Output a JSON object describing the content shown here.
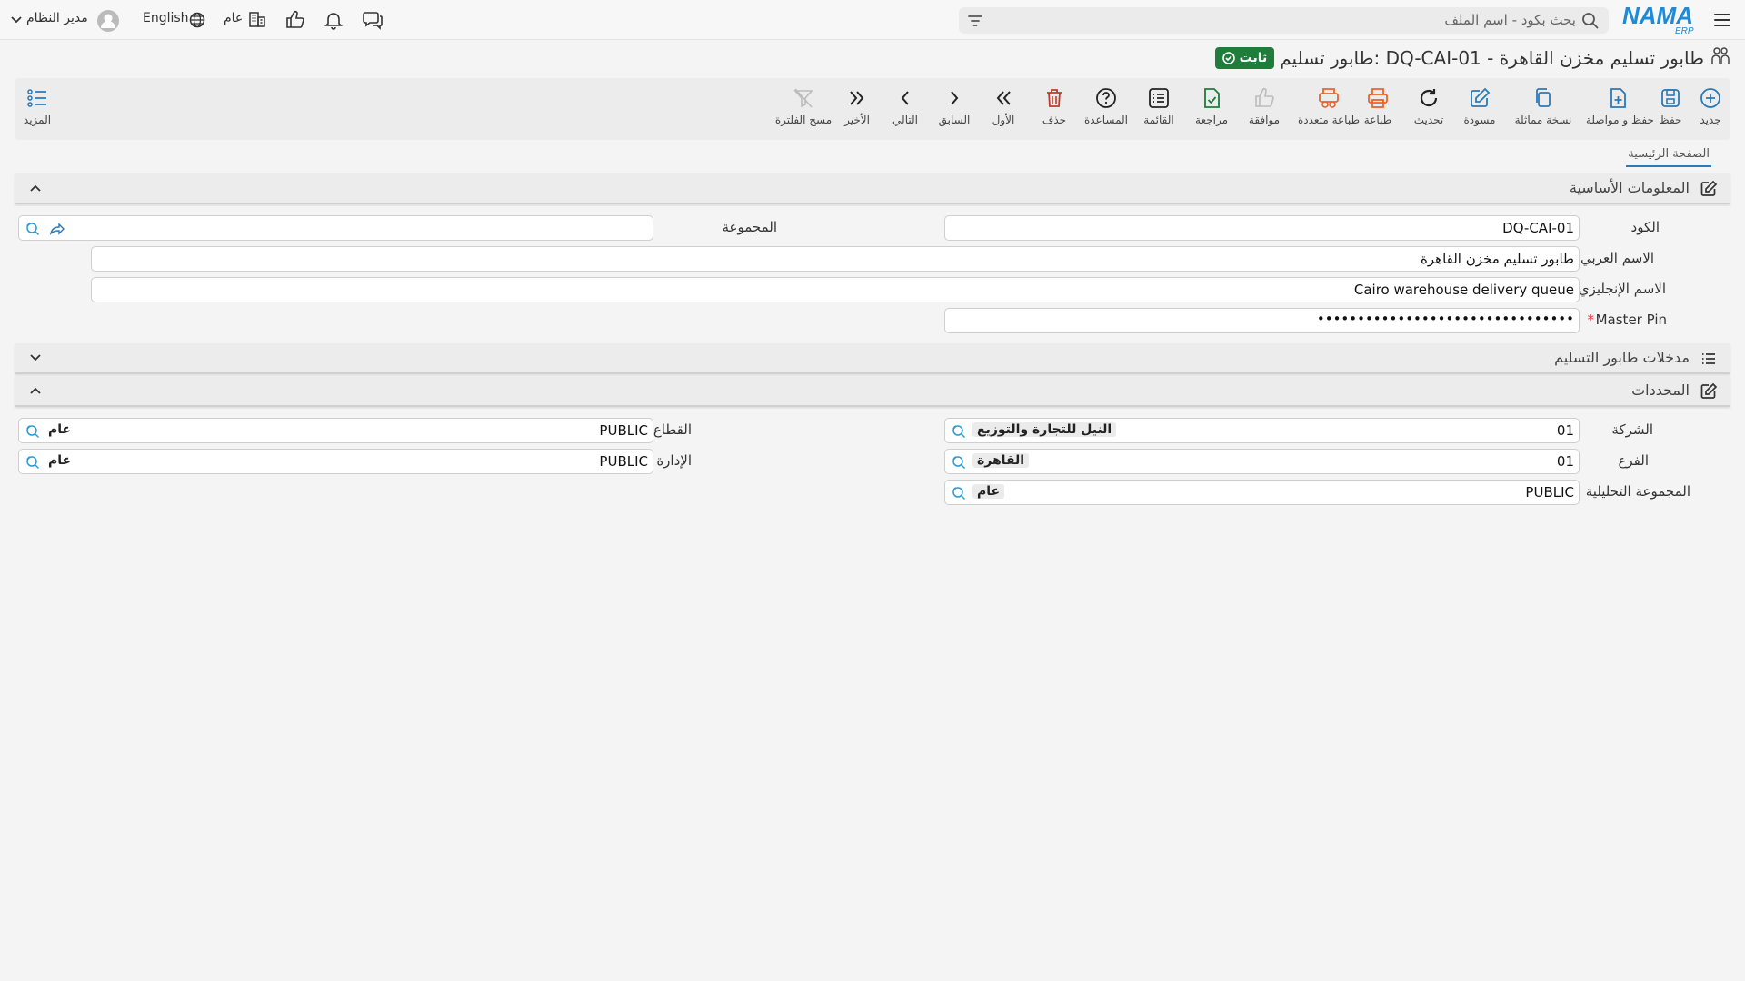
{
  "topbar": {
    "search_placeholder": "بحث بكود - اسم الملف",
    "logo_text": "NAMA",
    "logo_sub": "ERP",
    "branch_label": "عام",
    "language_label": "English",
    "user_name": "مدير النظام"
  },
  "header": {
    "title": "طابور تسليم: DQ-CAI-01 - طابور تسليم مخزن القاهرة",
    "status": "ثابت"
  },
  "toolbar": {
    "new": "جديد",
    "save": "حفظ",
    "save_continue": "حفظ و مواصلة",
    "duplicate": "نسخة مماثلة",
    "draft": "مسودة",
    "refresh": "تحديث",
    "print": "طباعة",
    "multi_print": "طباعة متعددة",
    "approve": "موافقة",
    "review": "مراجعة",
    "list": "القائمة",
    "help": "المساعدة",
    "delete": "حذف",
    "first": "الأول",
    "previous": "السابق",
    "next": "التالي",
    "last": "الأخير",
    "clear_filter": "مسح الفلترة",
    "more": "المزيد"
  },
  "tabs": {
    "main": "الصفحة الرئيسية"
  },
  "basic_info": {
    "title": "المعلومات الأساسية",
    "code_label": "الكود",
    "code_value": "DQ-CAI-01",
    "group_label": "المجموعة",
    "arabic_name_label": "الاسم العربي",
    "arabic_name_value": "طابور تسليم مخزن القاهرة",
    "english_name_label": "الاسم الإنجليزي",
    "english_name_value": "Cairo warehouse delivery queue",
    "master_pin_label": "Master Pin",
    "master_pin_required": "*",
    "master_pin_value": "••••••••••••••••••••••••••••••••"
  },
  "entries": {
    "title": "مدخلات طابور التسليم"
  },
  "dimensions": {
    "title": "المحددات",
    "company_label": "الشركة",
    "company_code": "01",
    "company_name": "النيل للتجارة والتوزيع",
    "sector_label": "القطاع",
    "sector_code": "PUBLIC",
    "sector_name": "عام",
    "branch_label": "الفرع",
    "branch_code": "01",
    "branch_name": "القاهرة",
    "department_label": "الإدارة",
    "department_code": "PUBLIC",
    "department_name": "عام",
    "analytic_label": "المجموعة التحليلية",
    "analytic_code": "PUBLIC",
    "analytic_name": "عام"
  },
  "colors": {
    "status_green": "#1e7d3a",
    "accent_blue": "#2a7ab8",
    "delete_red": "#c0392b",
    "print_orange": "#e8642b"
  }
}
